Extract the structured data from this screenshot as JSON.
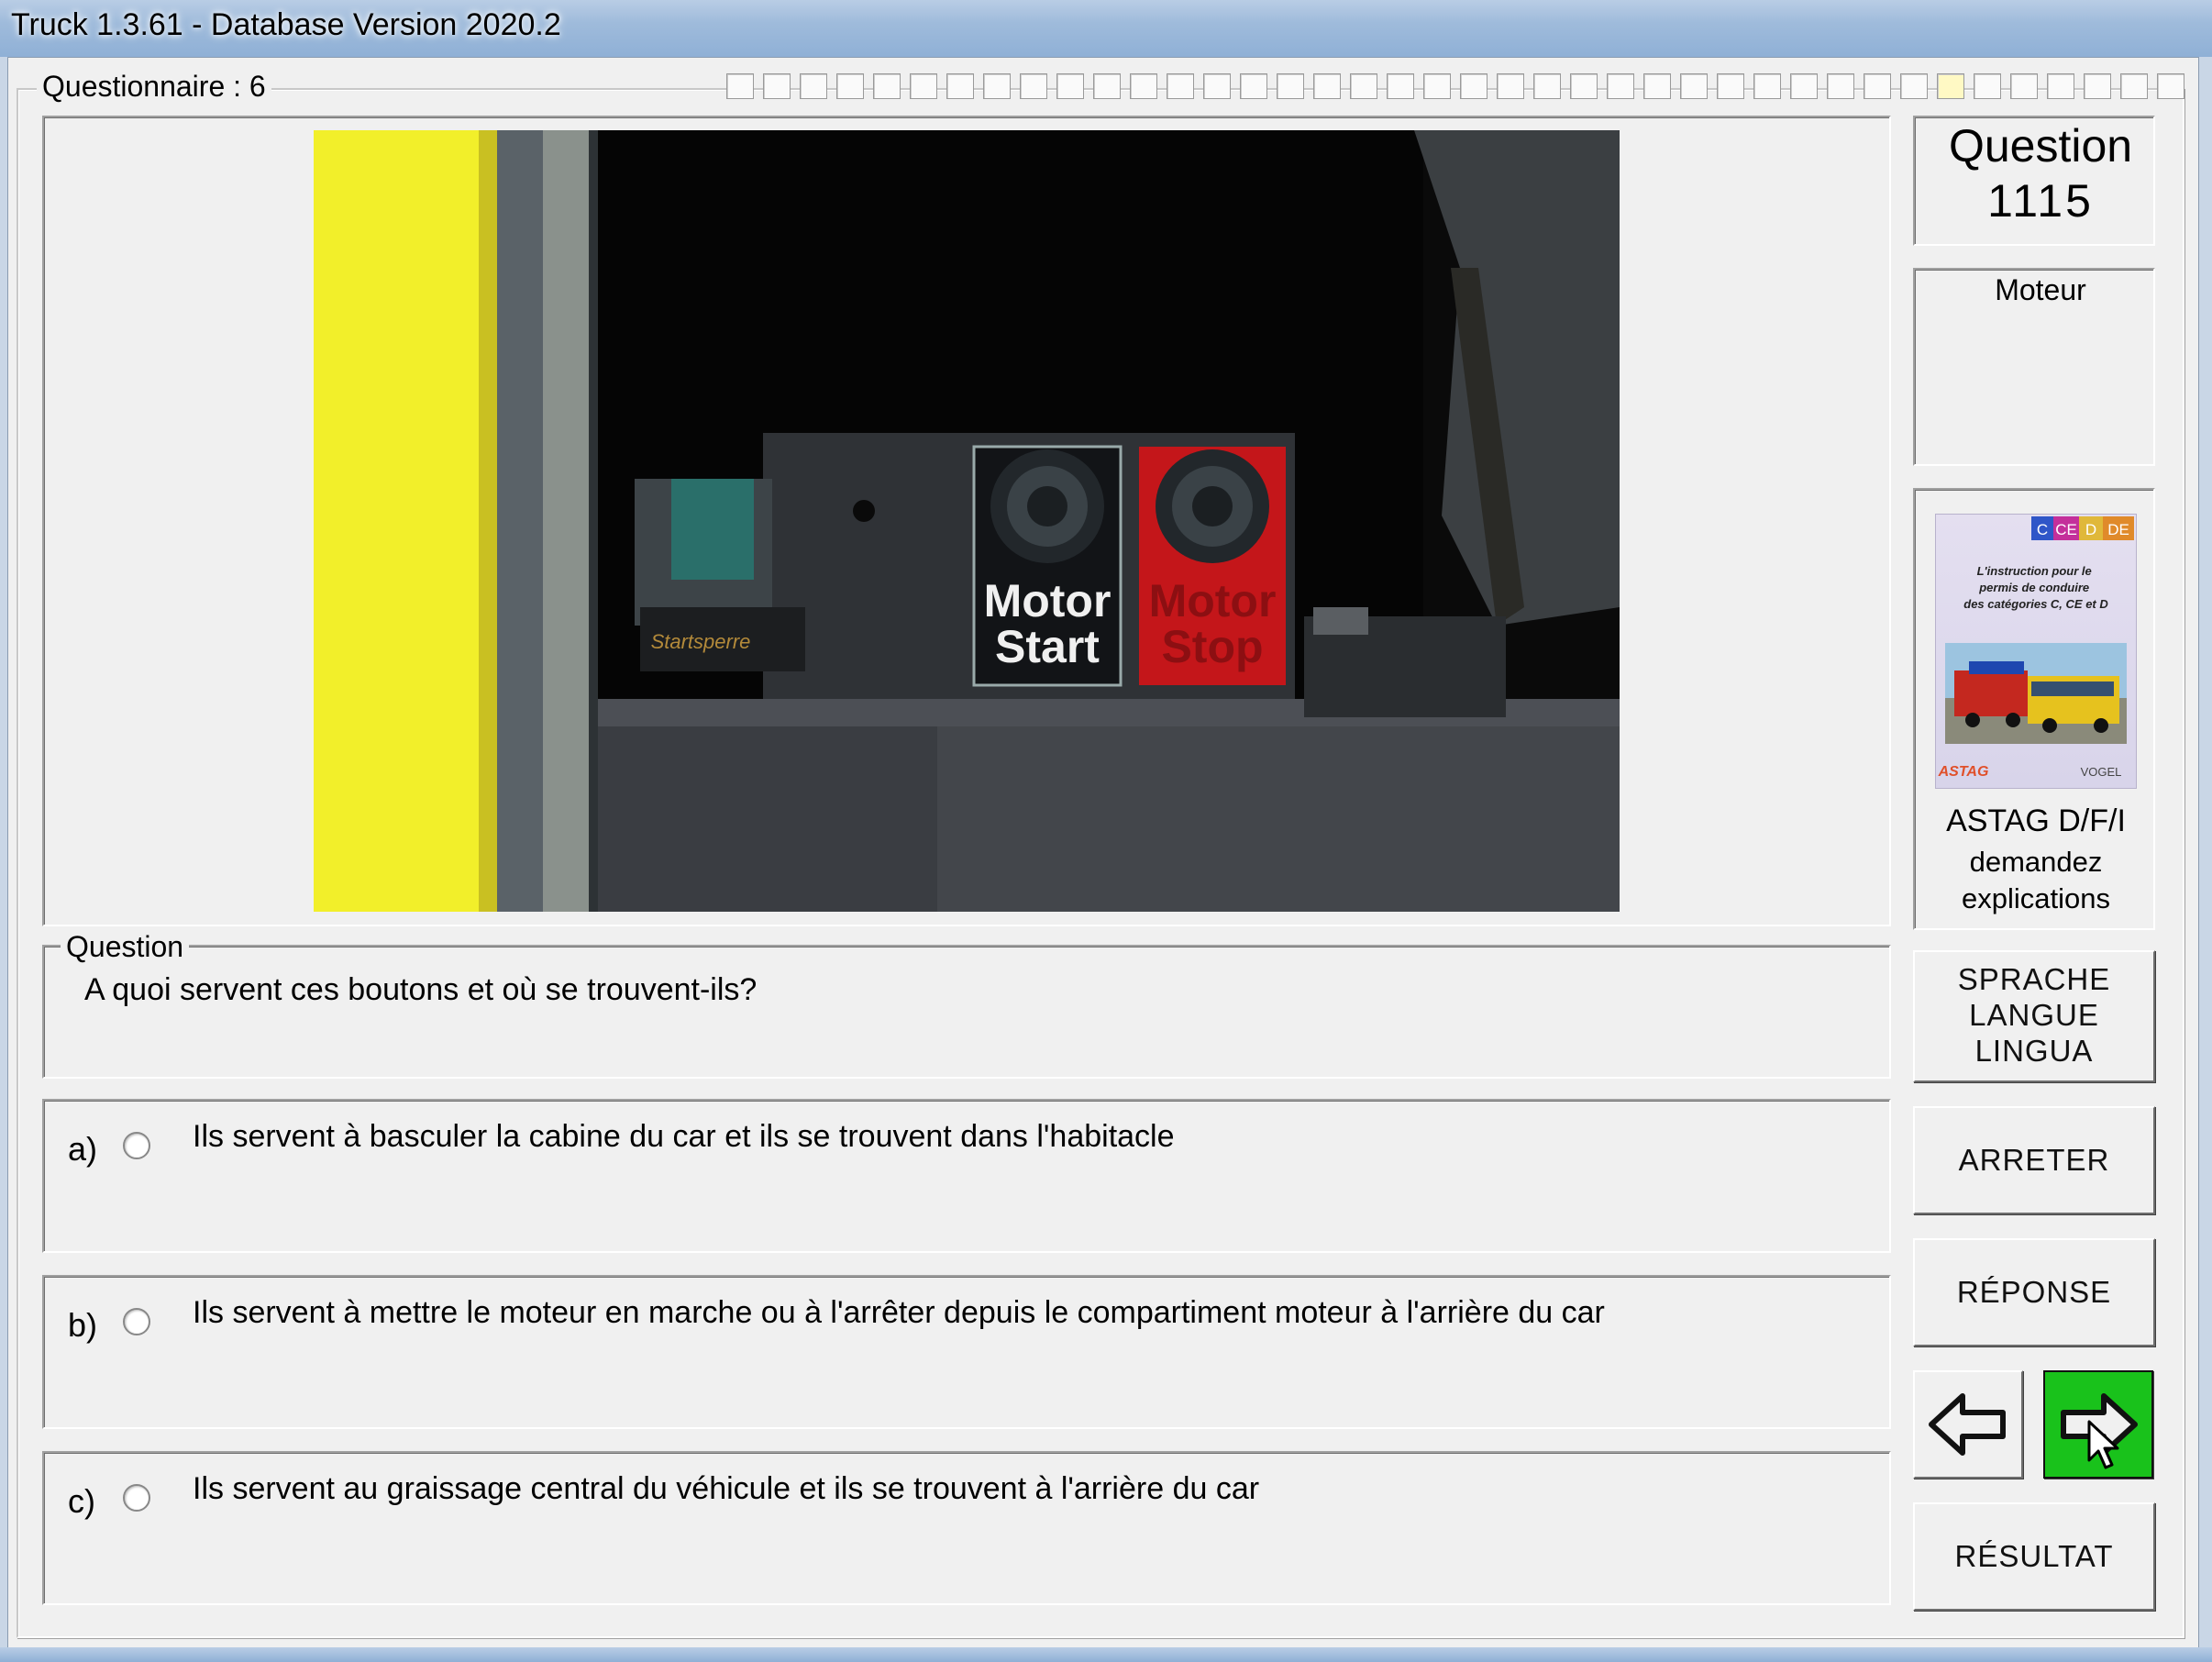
{
  "window": {
    "title": "Truck 1.3.61 - Database Version 2020.2"
  },
  "questionnaire": {
    "label": "Questionnaire : 6",
    "progress_total": 40,
    "progress_done_index": 33
  },
  "photo": {
    "button_left_line1": "Motor",
    "button_left_line2": "Start",
    "button_right_line1": "Motor",
    "button_right_line2": "Stop",
    "plate_text": "Startsperre"
  },
  "question": {
    "group_label": "Question",
    "text": "A quoi servent ces boutons et où se trouvent-ils?"
  },
  "answers": [
    {
      "letter": "a)",
      "text": "Ils servent à basculer la cabine du car et ils se trouvent dans l'habitacle",
      "selected": false
    },
    {
      "letter": "b)",
      "text": "Ils servent à mettre le moteur en marche ou à l'arrêter depuis le compartiment moteur à l'arrière du car",
      "selected": false
    },
    {
      "letter": "c)",
      "text": "Ils servent au graissage central du véhicule et ils se trouvent à l'arrière du car",
      "selected": false
    }
  ],
  "sidebar": {
    "question_title": "Question",
    "question_number": "1115",
    "category": "Moteur",
    "book": {
      "badges": [
        "C",
        "CE",
        "D",
        "DE"
      ],
      "subtitle": "L'instruction pour le permis de conduire des catégories C, CE et D",
      "publisher_left": "ASTAG",
      "publisher_right": "VOGEL",
      "caption_line1": "ASTAG D/F/I",
      "caption_line2": "demandez",
      "caption_line3": "explications"
    },
    "language_button": [
      "SPRACHE",
      "LANGUE",
      "LINGUA"
    ],
    "stop_button": "ARRETER",
    "answer_button": "RÉPONSE",
    "result_button": "RÉSULTAT"
  },
  "colors": {
    "next_button": "#19c21b",
    "window_bg": "#f0f0f0"
  }
}
